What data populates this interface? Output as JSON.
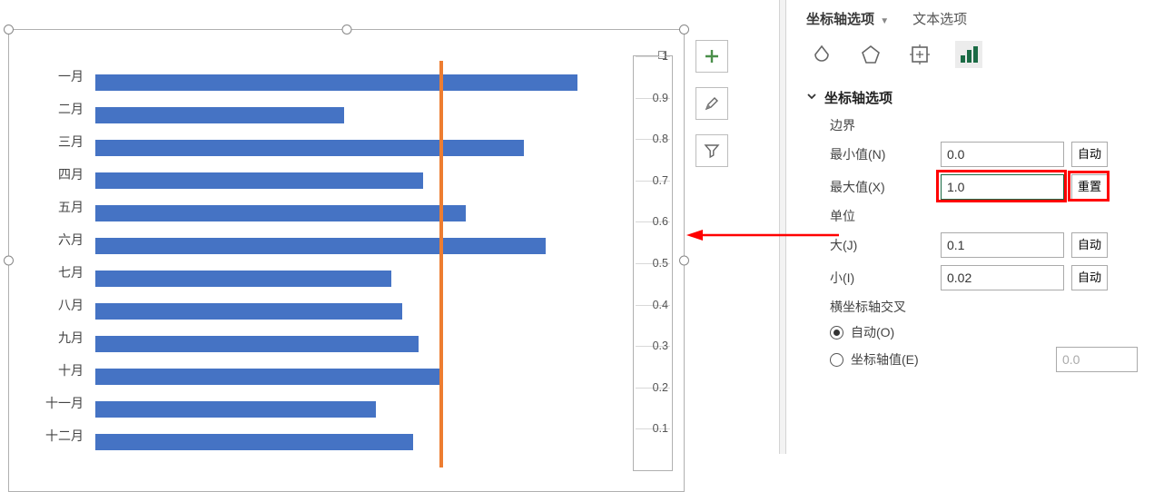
{
  "chart_data": {
    "type": "bar",
    "orientation": "horizontal",
    "categories": [
      "一月",
      "二月",
      "三月",
      "四月",
      "五月",
      "六月",
      "七月",
      "八月",
      "九月",
      "十月",
      "十一月",
      "十二月"
    ],
    "values": [
      91,
      47,
      81,
      62,
      70,
      85,
      56,
      58,
      61,
      65,
      53,
      60
    ],
    "average_line_at": 65,
    "xlim": [
      0,
      100
    ],
    "secondary_y_axis": {
      "min": 0.0,
      "max": 1.0,
      "major": 0.1,
      "ticks": [
        "1",
        "0.9",
        "0.8",
        "0.7",
        "0.6",
        "0.5",
        "0.4",
        "0.3",
        "0.2",
        "0.1"
      ]
    }
  },
  "chart_buttons": {
    "add": "+",
    "brush": "brush",
    "filter": "filter"
  },
  "pane": {
    "tabs": {
      "axis": "坐标轴选项",
      "text": "文本选项"
    },
    "section": "坐标轴选项",
    "bounds_label": "边界",
    "min_label": "最小值(N)",
    "min_value": "0.0",
    "min_btn": "自动",
    "max_label": "最大值(X)",
    "max_value": "1.0",
    "max_btn": "重置",
    "units_label": "单位",
    "major_label": "大(J)",
    "major_value": "0.1",
    "major_btn": "自动",
    "minor_label": "小(I)",
    "minor_value": "0.02",
    "minor_btn": "自动",
    "cross_label": "横坐标轴交叉",
    "cross_auto": "自动(O)",
    "cross_value": "坐标轴值(E)",
    "cross_value_input": "0.0"
  }
}
